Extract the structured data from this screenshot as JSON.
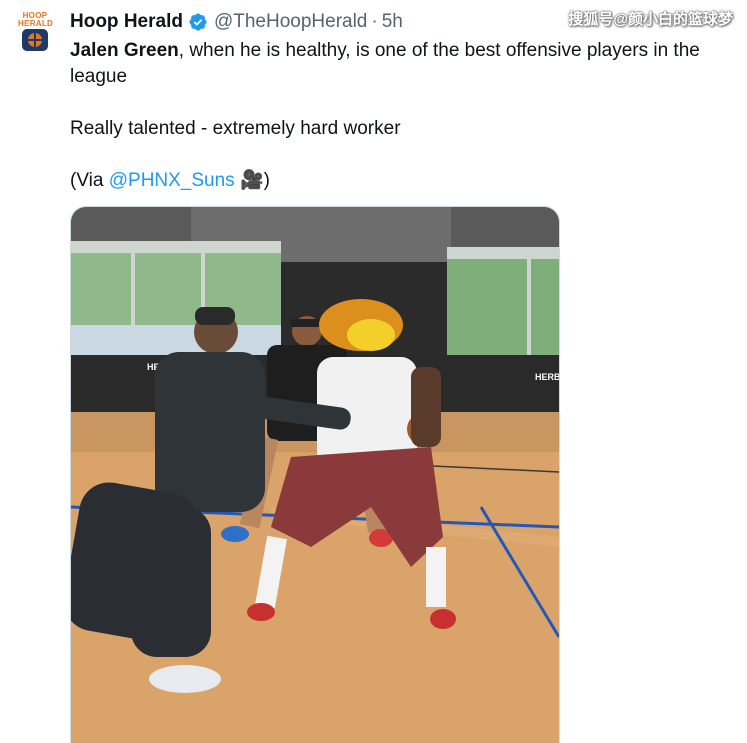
{
  "tweet": {
    "author_name": "Hoop Herald",
    "handle": "@TheHoopHerald",
    "separator": "·",
    "time": "5h",
    "text_bold": "Jalen Green",
    "text_line1_rest": ", when he is healthy, is one of the best offensive players in the league",
    "text_line2": "Really talented - extremely hard worker",
    "via_prefix": "(Via ",
    "via_mention": "@PHNX_Suns",
    "via_suffix": " 🎥)"
  },
  "avatar": {
    "logo_text_top": "HOOP",
    "logo_text_bottom": "HERALD"
  },
  "watermark": "搜狐号@颜小白的篮球梦",
  "media": {
    "wall_sign_left": "HERBA",
    "wall_sign_right": "HERB",
    "icon": "video-camera-icon",
    "colors": {
      "floor": "#d9a36a",
      "court_line": "#2458b8",
      "wall": "#2b2b2b"
    }
  },
  "colors": {
    "link": "#1d9bf0",
    "muted": "#536471",
    "verified": "#1d9bf0"
  }
}
